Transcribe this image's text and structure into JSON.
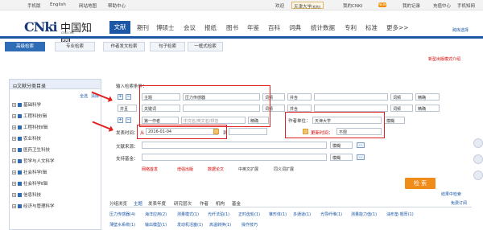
{
  "topbar": {
    "links": [
      "手机版",
      "English",
      "网站地图",
      "帮助中心"
    ],
    "welcome": "欢迎",
    "org": "天津大学",
    "org_suffix": "(机构)",
    "mycnki": "我的CNKI",
    "new_badge": "NEW",
    "myrecords": "我的记录",
    "recharge": "充值中心",
    "phone_cnki": "手机知网"
  },
  "logo": {
    "cn": "CNki",
    "name": "中国知网",
    "domain": "cnki.net"
  },
  "nav": {
    "active": "文献",
    "items": [
      "期刊",
      "博硕士",
      "会议",
      "报纸",
      "图书",
      "年鉴",
      "百科",
      "词典",
      "统计数据",
      "专利",
      "标准",
      "更多>>"
    ]
  },
  "header_right": "跨库选择",
  "search_tabs": [
    "高级检索",
    "专业检索",
    "作者发文检索",
    "句子检索",
    "一框式检索"
  ],
  "mode_link": "新型出版模式介绍",
  "sidebar": {
    "title": "文献分类目录",
    "select_all": "全选",
    "clear": "清除",
    "items": [
      "基础科学",
      "工程科技Ⅰ辑",
      "工程科技Ⅱ辑",
      "农业科技",
      "医药卫生科技",
      "哲学与人文科学",
      "社会科学Ⅰ辑",
      "社会科学Ⅱ辑",
      "信息科技",
      "经济与管理科学"
    ]
  },
  "form": {
    "input_label": "输入检索条件：",
    "row1": {
      "field": "主题",
      "value": "压力传感器",
      "freq": "词频",
      "logic": "并含",
      "freq2": "词频",
      "match": "精确"
    },
    "row2": {
      "logic": "并且",
      "field": "关键词",
      "freq": "词频",
      "logic2": "并含",
      "freq2": "词频",
      "match": "精确"
    },
    "author_row": {
      "role": "第一作者",
      "placeholder": "中文名/英文名/拼音",
      "match": "精确",
      "unit_label": "作者单位：",
      "unit_value": "天津大学",
      "match2": "模糊"
    },
    "time_row": {
      "label": "发表时间：",
      "from_label": "从",
      "from_value": "2016-01-04",
      "to_label": "到",
      "update_label": "更新时间：",
      "update_value": "不限"
    },
    "source_label": "文献来源：",
    "source_match": "模糊",
    "fund_label": "支持基金：",
    "fund_match": "模糊",
    "checkboxes": [
      "网络首发",
      "增强出版",
      "数据论文",
      "中英文扩展",
      "同义词扩展"
    ],
    "search_button": "检 索",
    "result_settings": "结果中检索"
  },
  "result_tabs": [
    "分组浏览",
    "主题",
    "发表年度",
    "研究层次",
    "作者",
    "机构",
    "基金"
  ],
  "result_right": "免费订阅",
  "topics_row1": [
    "压力传感器(4)",
    "海洋应用(2)",
    "测量模式(1)",
    "光纤法珀(1)",
    "正时齿轮(1)",
    "锥形体(1)",
    "多通道(1)",
    "光导纤维(1)",
    "测量能力值(1)",
    "油布垫·翘厚(1)"
  ],
  "topics_row2": [
    "薄壁水系统(1)",
    "输出模型(1)",
    "发动机活塞(1)",
    "高温转换(1)",
    "操作技巧"
  ]
}
